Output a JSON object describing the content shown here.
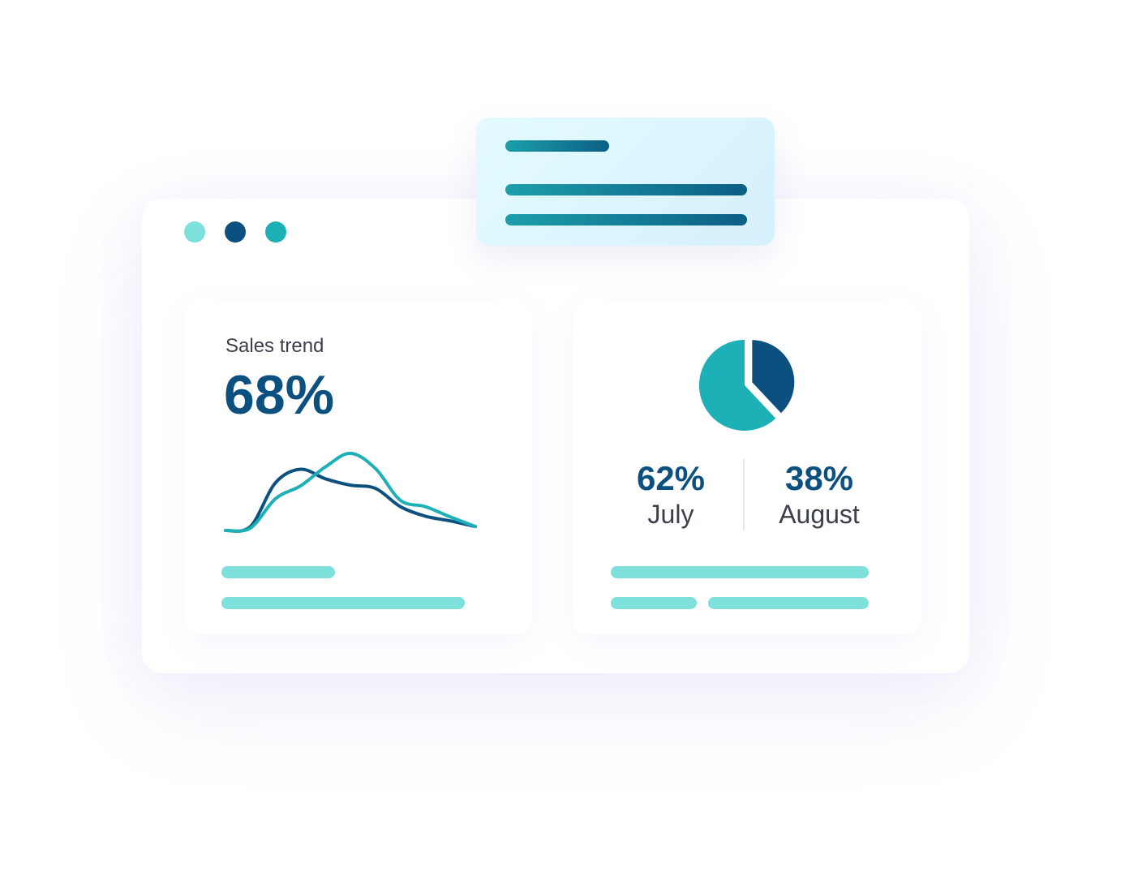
{
  "window": {
    "control_colors": [
      "#7de0db",
      "#0c5080",
      "#1db0b6"
    ]
  },
  "popup": {
    "bar_colors": {
      "start": "#1c9fab",
      "end": "#0c5e85"
    }
  },
  "sales_card": {
    "title": "Sales trend",
    "value": "68%"
  },
  "distribution_card": {
    "stats": [
      {
        "value": "62%",
        "label": "July"
      },
      {
        "value": "38%",
        "label": "August"
      }
    ]
  },
  "colors": {
    "primary": "#0c5080",
    "teal": "#1db0b6",
    "light_teal": "#7de0db",
    "text": "#3a3f4a"
  },
  "chart_data": [
    {
      "type": "line",
      "title": "",
      "x": [
        0,
        1,
        2,
        3,
        4,
        5,
        6,
        7,
        8,
        9,
        10
      ],
      "series": [
        {
          "color": "#0c5080",
          "values": [
            0,
            5,
            60,
            77,
            65,
            57,
            53,
            30,
            18,
            12,
            5
          ]
        },
        {
          "color": "#1db0b6",
          "values": [
            0,
            3,
            40,
            56,
            80,
            97,
            78,
            38,
            30,
            17,
            5
          ]
        }
      ],
      "ylim": [
        0,
        100
      ],
      "grid": false
    },
    {
      "type": "pie",
      "title": "",
      "categories": [
        "July",
        "August"
      ],
      "values": [
        62,
        38
      ],
      "colors": [
        "#1db0b6",
        "#0c5080"
      ],
      "exploded_slice": "August"
    }
  ]
}
